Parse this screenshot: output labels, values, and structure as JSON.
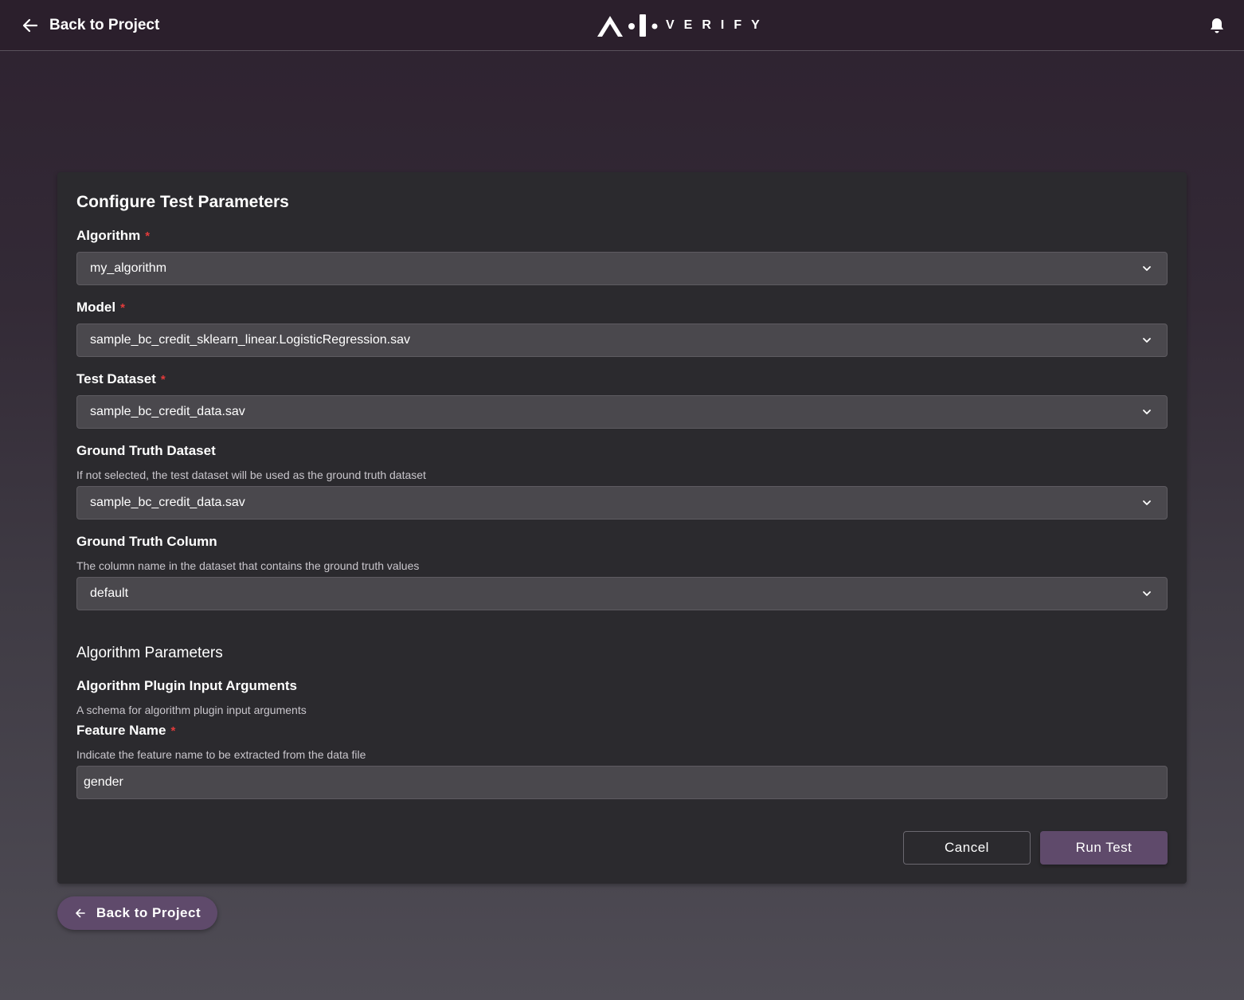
{
  "header": {
    "back_label": "Back to Project",
    "logo_text": "VERIFY",
    "icons": {
      "back": "arrow-left-icon",
      "notifications": "bell-icon"
    }
  },
  "form": {
    "title": "Configure Test Parameters",
    "algorithm": {
      "label": "Algorithm",
      "required": "*",
      "value": "my_algorithm"
    },
    "model": {
      "label": "Model",
      "required": "*",
      "value": "sample_bc_credit_sklearn_linear.LogisticRegression.sav"
    },
    "test_dataset": {
      "label": "Test Dataset",
      "required": "*",
      "value": "sample_bc_credit_data.sav"
    },
    "ground_truth_dataset": {
      "label": "Ground Truth Dataset",
      "description": "If not selected, the test dataset will be used as the ground truth dataset",
      "value": "sample_bc_credit_data.sav"
    },
    "ground_truth_column": {
      "label": "Ground Truth Column",
      "description": "The column name in the dataset that contains the ground truth values",
      "value": "default"
    },
    "algorithm_parameters": {
      "title": "Algorithm Parameters",
      "plugin_args_title": "Algorithm Plugin Input Arguments",
      "plugin_args_description": "A schema for algorithm plugin input arguments",
      "feature_name": {
        "label": "Feature Name",
        "required": "*",
        "description": "Indicate the feature name to be extracted from the data file",
        "value": "gender"
      }
    },
    "actions": {
      "cancel_label": "Cancel",
      "run_label": "Run Test"
    }
  },
  "footer": {
    "back_label": "Back to Project"
  },
  "colors": {
    "accent": "#5f4a6b",
    "required": "#e23b3b",
    "card_bg": "#2b2a2e",
    "input_bg": "#4a484d"
  }
}
